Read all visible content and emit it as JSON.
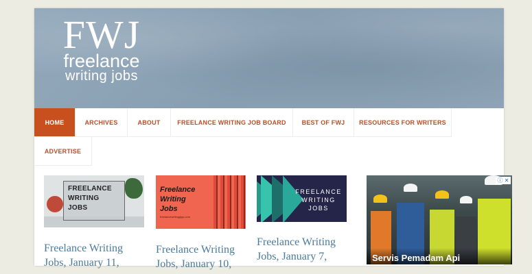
{
  "logo": {
    "abbr": "FWJ",
    "line1": "freelance",
    "line2": "writing jobs"
  },
  "nav": {
    "items": [
      {
        "label": "HOME",
        "active": true
      },
      {
        "label": "ARCHIVES"
      },
      {
        "label": "ABOUT"
      },
      {
        "label": "FREELANCE WRITING JOB BOARD"
      },
      {
        "label": "BEST OF FWJ"
      },
      {
        "label": "RESOURCES FOR WRITERS"
      },
      {
        "label": "ADVERTISE"
      }
    ]
  },
  "posts": [
    {
      "thumb_text": [
        "FREELANCE",
        "WRITING",
        "JOBS"
      ],
      "title_line1": "Freelance Writing",
      "title_line2": "Jobs, January 11,"
    },
    {
      "thumb_text": [
        "Freelance",
        "Writing",
        "Jobs"
      ],
      "thumb_small": "freelancewritinggigs.com",
      "title_line1": "Freelance Writing",
      "title_line2": "Jobs, January 10,"
    },
    {
      "thumb_text": [
        "FREELANCE",
        "WRITING",
        "JOBS"
      ],
      "title_line1": "Freelance Writing",
      "title_line2": "Jobs, January 7,"
    }
  ],
  "ad": {
    "caption": "Servis Pemadam Api",
    "adchoices": "ⓘ ✕"
  },
  "colors": {
    "accent": "#c8501f",
    "nav_text": "#b4502a",
    "title": "#4a7a9c",
    "header": "#8fa5b7"
  }
}
